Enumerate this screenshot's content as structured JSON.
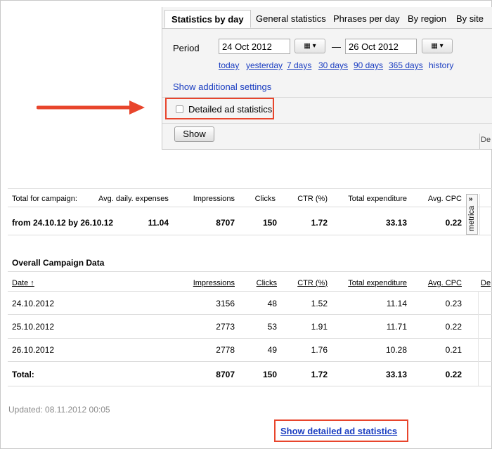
{
  "tabs": [
    "Statistics by day",
    "General statistics",
    "Phrases per day",
    "By region",
    "By site"
  ],
  "period": {
    "label": "Period",
    "from": "24 Oct 2012",
    "to": "26 Oct 2012",
    "dash": "—",
    "calendar_glyph": "▦ ▾"
  },
  "quick_ranges": [
    "today",
    "yesterday",
    "7 days",
    "30 days",
    "90 days",
    "365 days",
    "history"
  ],
  "additional_settings": "Show additional settings",
  "detailed_checkbox": {
    "label": "Detailed ad statistics",
    "checked": false
  },
  "show_button": "Show",
  "side_tab_label": "De",
  "summary": {
    "headers": [
      "Total for campaign:",
      "Avg. daily. expenses",
      "Impressions",
      "Clicks",
      "CTR (%)",
      "Total expenditure",
      "Avg. CPC"
    ],
    "row": [
      "from 24.10.12 by 26.10.12",
      "11.04",
      "8707",
      "150",
      "1.72",
      "33.13",
      "0.22"
    ]
  },
  "metrica": {
    "label": "metrica",
    "arrow": "»"
  },
  "overall": {
    "title": "Overall Campaign Data",
    "columns": [
      "Date ↑",
      "Impressions",
      "Clicks",
      "CTR (%)",
      "Total expenditure",
      "Avg. CPC",
      "De"
    ],
    "rows": [
      [
        "24.10.2012",
        "3156",
        "48",
        "1.52",
        "11.14",
        "0.23"
      ],
      [
        "25.10.2012",
        "2773",
        "53",
        "1.91",
        "11.71",
        "0.22"
      ],
      [
        "26.10.2012",
        "2778",
        "49",
        "1.76",
        "10.28",
        "0.21"
      ]
    ],
    "total": [
      "Total:",
      "8707",
      "150",
      "1.72",
      "33.13",
      "0.22"
    ]
  },
  "updated": "Updated: 08.11.2012 00:05",
  "show_detailed_link": "Show detailed ad statistics",
  "accent_color": "#e8452c",
  "link_color": "#1a3dc1"
}
